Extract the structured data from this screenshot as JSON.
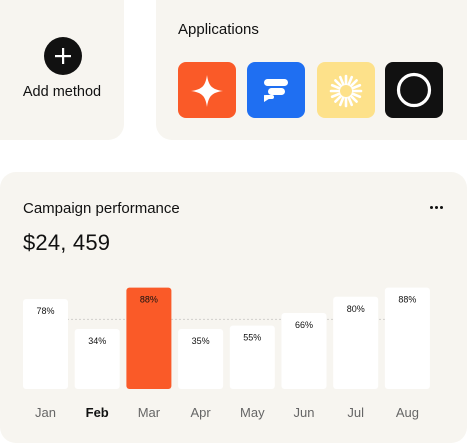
{
  "add_method": {
    "label": "Add method",
    "icon": "plus-icon"
  },
  "applications": {
    "title": "Applications",
    "apps": [
      {
        "icon": "sparkle-icon",
        "color": "#fa5a28"
      },
      {
        "icon": "chat-bubble-icon",
        "color": "#1f6ff2"
      },
      {
        "icon": "sun-burst-icon",
        "color": "#fde18a"
      },
      {
        "icon": "ring-icon",
        "color": "#111111"
      }
    ]
  },
  "campaign": {
    "title": "Campaign performance",
    "more_icon": "more-horizontal-icon",
    "amount": "$24, 459"
  },
  "chart_data": {
    "type": "bar",
    "categories": [
      "Jan",
      "Feb",
      "Mar",
      "Apr",
      "May",
      "Jun",
      "Jul",
      "Aug"
    ],
    "values": [
      78,
      34,
      88,
      35,
      55,
      66,
      80,
      88
    ],
    "value_labels": [
      "78%",
      "34%",
      "88%",
      "35%",
      "55%",
      "66%",
      "80%",
      "88%"
    ],
    "highlighted_index": 2,
    "bold_category_index": 1,
    "accent_color": "#fa5a28",
    "reference_line": "dashed",
    "ylim": [
      0,
      100
    ]
  }
}
